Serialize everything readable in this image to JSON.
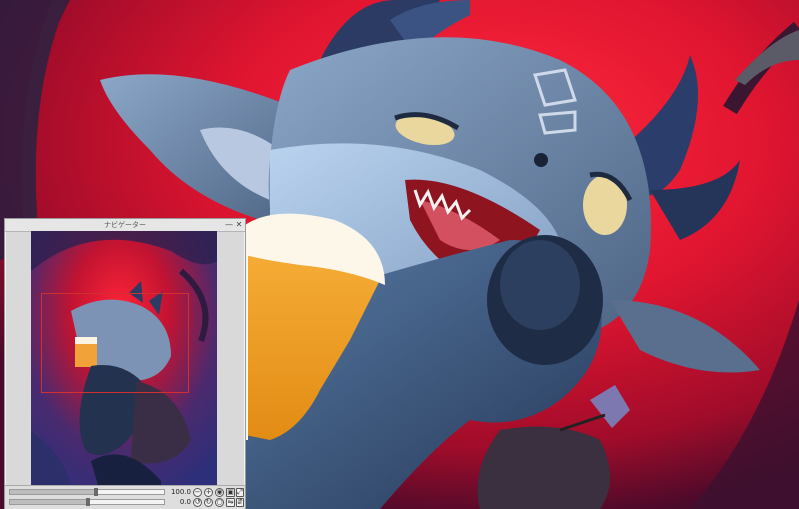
{
  "navigator": {
    "title": "ナビゲーター",
    "minimize_label": "—",
    "close_label": "✕",
    "zoom_value": "100.0",
    "rotate_value": "0.0",
    "icons": {
      "zoom_out": "minus-circle-icon",
      "zoom_in": "plus-circle-icon",
      "fit": "fit-window-icon",
      "actual": "actual-size-icon",
      "expand": "expand-icon",
      "rotate_left": "rotate-left-icon",
      "rotate_right": "rotate-right-icon",
      "reset_rotation": "reset-rotation-icon",
      "flip": "flip-horizontal-icon",
      "flip_v": "flip-vertical-icon"
    },
    "zoom_slider_level": 0.55,
    "rotate_slider_level": 0.5
  },
  "colors": {
    "panel_bg": "#d9d9d9",
    "view_rect": "#d03030",
    "canvas_red": "#d8192f"
  }
}
